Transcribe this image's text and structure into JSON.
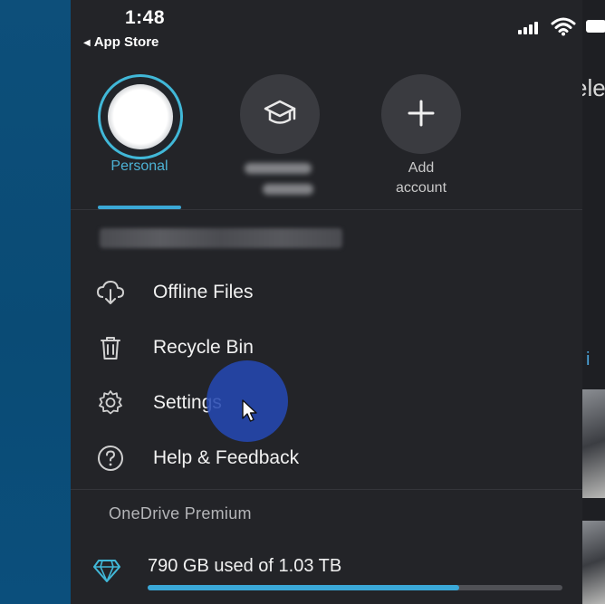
{
  "status_bar": {
    "time": "1:48",
    "back_label": "App Store",
    "signal_icon": "cellular-signal-icon",
    "wifi_icon": "wifi-icon",
    "battery_icon": "battery-icon"
  },
  "accounts": [
    {
      "label": "Personal",
      "icon": "avatar",
      "active": true
    },
    {
      "label": "",
      "icon": "graduation-cap-icon",
      "active": false
    },
    {
      "label": "Add\naccount",
      "icon": "plus-icon",
      "active": false
    }
  ],
  "menu": [
    {
      "label": "Offline Files",
      "icon": "cloud-download-icon"
    },
    {
      "label": "Recycle Bin",
      "icon": "trash-icon"
    },
    {
      "label": "Settings",
      "icon": "gear-icon"
    },
    {
      "label": "Help & Feedback",
      "icon": "help-circle-icon"
    }
  ],
  "premium": {
    "section_title": "OneDrive Premium",
    "storage_text": "790 GB used of 1.03 TB",
    "storage_icon": "diamond-icon",
    "used_fraction": 0.75
  },
  "background_peek": {
    "title_fragment": "ele",
    "blue_fragment": "i"
  },
  "colors": {
    "accent": "#3ba8d6",
    "drawer_bg": "#232428",
    "click_indicator": "#2448b0"
  }
}
